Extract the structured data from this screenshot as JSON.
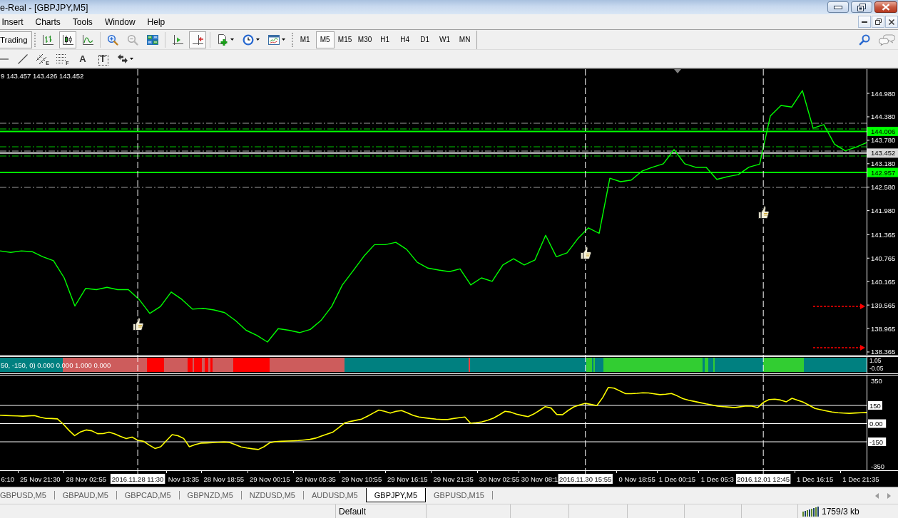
{
  "window": {
    "title": "e-Real - [GBPJPY,M5]"
  },
  "menu": [
    "Insert",
    "Charts",
    "Tools",
    "Window",
    "Help"
  ],
  "toolbar": {
    "trading": "Trading",
    "tools": [
      {
        "kind": "bars",
        "selected": false
      },
      {
        "kind": "candles",
        "selected": true
      },
      {
        "kind": "line",
        "selected": false
      },
      {
        "kind": "zoom-in",
        "selected": false
      },
      {
        "kind": "zoom-out",
        "selected": false
      },
      {
        "kind": "tile",
        "selected": false
      },
      {
        "kind": "shift",
        "selected": false
      },
      {
        "kind": "autoscroll",
        "selected": true
      },
      {
        "kind": "new-chart",
        "selected": false
      },
      {
        "kind": "periods",
        "selected": false
      },
      {
        "kind": "templates",
        "selected": false
      }
    ],
    "timeframes": [
      {
        "label": "M1",
        "selected": false
      },
      {
        "label": "M5",
        "selected": true
      },
      {
        "label": "M15",
        "selected": false
      },
      {
        "label": "M30",
        "selected": false
      },
      {
        "label": "H1",
        "selected": false
      },
      {
        "label": "H4",
        "selected": false
      },
      {
        "label": "D1",
        "selected": false
      },
      {
        "label": "W1",
        "selected": false
      },
      {
        "label": "MN",
        "selected": false
      }
    ]
  },
  "drawing_tools": [
    {
      "kind": "hline"
    },
    {
      "kind": "trendline"
    },
    {
      "kind": "channel",
      "label": "E"
    },
    {
      "kind": "fibo",
      "label": "F"
    },
    {
      "kind": "text",
      "label": "A"
    },
    {
      "kind": "label",
      "label": "T"
    },
    {
      "kind": "arrows"
    }
  ],
  "chart": {
    "ohlc": "9 143.457 143.426 143.452",
    "chart_data": {
      "type": "line",
      "ylim": [
        138.31,
        145.6
      ],
      "categories": [
        null,
        null,
        null,
        null,
        null,
        null,
        null,
        null,
        null,
        null,
        null,
        null,
        null,
        null,
        null,
        null,
        null,
        null,
        null,
        null,
        null,
        null,
        null,
        null,
        null,
        null,
        null,
        null,
        null,
        null,
        null,
        null,
        null,
        null,
        null,
        null,
        null,
        null,
        null,
        null,
        null,
        null,
        null,
        null,
        null,
        null,
        null,
        null,
        null,
        null,
        null,
        null,
        null,
        null,
        null,
        null,
        null,
        null,
        null,
        null,
        null,
        null,
        null,
        null,
        null,
        null,
        null,
        null,
        null,
        null,
        null,
        null,
        null,
        null,
        null,
        null,
        null,
        null,
        null,
        null,
        null,
        null
      ],
      "series": [
        {
          "color": "#00ff00",
          "values": [
            140.95,
            140.91,
            140.95,
            140.93,
            140.8,
            140.7,
            140.26,
            139.54,
            139.99,
            139.96,
            140.02,
            139.96,
            139.96,
            139.71,
            139.35,
            139.53,
            139.9,
            139.71,
            139.46,
            139.48,
            139.44,
            139.37,
            139.17,
            138.92,
            138.79,
            138.62,
            138.96,
            138.92,
            138.86,
            138.94,
            139.17,
            139.53,
            140.08,
            140.44,
            140.81,
            141.11,
            141.11,
            141.17,
            140.99,
            140.66,
            140.51,
            140.46,
            140.42,
            140.49,
            140.08,
            140.26,
            140.17,
            140.59,
            140.75,
            140.59,
            140.72,
            141.35,
            140.8,
            140.9,
            141.26,
            141.54,
            141.4,
            142.81,
            142.72,
            142.76,
            142.99,
            143.09,
            143.18,
            143.54,
            143.18,
            143.09,
            143.09,
            142.78,
            142.85,
            142.9,
            143.09,
            143.17,
            144.4,
            144.67,
            144.63,
            145.05,
            144.09,
            144.18,
            143.68,
            143.51,
            143.6,
            143.72
          ]
        }
      ],
      "yticks": [
        {
          "value": 144.98,
          "label": "144.980"
        },
        {
          "value": 144.38,
          "label": "144.380"
        },
        {
          "value": 143.78,
          "label": "143.780"
        },
        {
          "value": 143.18,
          "label": "143.180"
        },
        {
          "value": 142.58,
          "label": "142.580"
        },
        {
          "value": 141.98,
          "label": "141.980"
        },
        {
          "value": 141.365,
          "label": "141.365"
        },
        {
          "value": 140.765,
          "label": "140.765"
        },
        {
          "value": 140.165,
          "label": "140.165"
        },
        {
          "value": 139.565,
          "label": "139.565"
        },
        {
          "value": 138.965,
          "label": "138.965"
        },
        {
          "value": 138.365,
          "label": "138.365"
        }
      ],
      "ref_lines": [
        {
          "axis": "y",
          "value": 144.215,
          "color": "#a0a0a0"
        },
        {
          "axis": "y",
          "value": 144.069,
          "color": "#00c800"
        },
        {
          "axis": "y",
          "value": 144.006,
          "color": "#00ff00",
          "label": "144.006"
        },
        {
          "axis": "y",
          "value": 143.613,
          "color": "#00c800"
        },
        {
          "axis": "y",
          "value": 143.504,
          "color": "#a0a0a0"
        },
        {
          "axis": "y",
          "value": 143.452,
          "color": "#d8d8d8",
          "label": "143.452"
        },
        {
          "axis": "y",
          "value": 143.377,
          "color": "#00c800"
        },
        {
          "axis": "y",
          "value": 142.957,
          "color": "#00ff00",
          "label": "142.957"
        },
        {
          "axis": "y",
          "value": 142.575,
          "color": "#a0a0a0"
        }
      ]
    }
  },
  "strip": {
    "label": "50, -150, 0) 0.000 0.000 1.000 0.000",
    "axis": [
      "1.05",
      "-0.05"
    ]
  },
  "oscillator": {
    "chart_data": {
      "type": "line",
      "ylim": [
        -385,
        397
      ],
      "categories": [
        null,
        "6:10",
        null,
        null,
        null,
        null,
        null,
        "25 Nov 21:30",
        null,
        null,
        null,
        null,
        null,
        null,
        null,
        "28 Nov 02:55",
        null,
        null,
        null,
        null,
        null,
        null,
        null,
        null,
        "2016.11.28 11:30",
        null,
        null,
        null,
        null,
        null,
        null,
        null,
        "Nov 13:35",
        null,
        null,
        null,
        null,
        null,
        null,
        "28 Nov 18:55",
        null,
        null,
        null,
        null,
        null,
        null,
        null,
        "29 Nov 00:15",
        null,
        null,
        null,
        null,
        null,
        null,
        null,
        "29 Nov 05:35",
        null,
        null,
        null,
        null,
        null,
        null,
        null,
        "29 Nov 10:55",
        null,
        null,
        null,
        null,
        null,
        null,
        null,
        "29 Nov 16:15",
        null,
        null,
        null,
        null,
        null,
        null,
        null,
        "29 Nov 21:35",
        null,
        null,
        null,
        null,
        null,
        null,
        null,
        "30 Nov 02:55",
        null,
        null,
        null,
        null,
        null,
        null,
        "30 Nov 08:1",
        null,
        null,
        null,
        null,
        null,
        null,
        null,
        "2016.11.30 15:55",
        null,
        null,
        null,
        null,
        null,
        null,
        null,
        null,
        "0 Nov 18:55",
        null,
        null,
        null,
        null,
        null,
        null,
        "1 Dec 00:15",
        null,
        null,
        null,
        null,
        null,
        null,
        "1 Dec 05:3",
        null,
        null,
        null,
        null,
        null,
        null,
        null,
        "2016.12.01 12:45",
        null,
        null,
        null,
        null,
        null,
        null,
        null,
        null,
        "1 Dec 16:15",
        null,
        null,
        null,
        null,
        null,
        null,
        null,
        "1 Dec 21:35",
        null
      ],
      "series": [
        {
          "color": "#ffff00",
          "values": [
            69,
            67,
            65,
            63,
            61,
            64,
            66,
            53,
            43,
            42,
            39,
            -3,
            -55,
            -99,
            -69,
            -52,
            -59,
            -83,
            -82,
            -70,
            -86,
            -106,
            -124,
            -111,
            -138,
            -146,
            -177,
            -205,
            -191,
            -141,
            -91,
            -100,
            -123,
            -191,
            -174,
            -161,
            -159,
            -157,
            -154,
            -152,
            -155,
            -174,
            -192,
            -201,
            -208,
            -214,
            -191,
            -158,
            -148,
            -146,
            -144,
            -142,
            -140,
            -135,
            -130,
            -120,
            -103,
            -87,
            -70,
            -34,
            4,
            17,
            27,
            37,
            60,
            86,
            112,
            102,
            87,
            102,
            108,
            88,
            68,
            54,
            48,
            42,
            37,
            34,
            34,
            42,
            49,
            55,
            3,
            8,
            14,
            28,
            46,
            72,
            101,
            95,
            78,
            67,
            58,
            79,
            109,
            140,
            129,
            76,
            73,
            109,
            138,
            154,
            167,
            158,
            149,
            214,
            299,
            293,
            270,
            247,
            247,
            250,
            254,
            253,
            246,
            239,
            243,
            249,
            229,
            206,
            193,
            183,
            173,
            163,
            154,
            144,
            140,
            136,
            132,
            139,
            146,
            144,
            132,
            175,
            199,
            202,
            195,
            180,
            209,
            193,
            176,
            151,
            125,
            115,
            105,
            96,
            90,
            87,
            85,
            88,
            90,
            92
          ]
        }
      ],
      "yticks": [
        {
          "value": 350,
          "label": "350"
        },
        {
          "value": -350,
          "label": "-350"
        }
      ],
      "ref_lines": [
        {
          "axis": "y",
          "value": 150,
          "label": "150"
        },
        {
          "axis": "y",
          "value": 0,
          "label": "0.00"
        },
        {
          "axis": "y",
          "value": -150,
          "label": "-150"
        }
      ]
    }
  },
  "tabs": [
    {
      "label": "GBPUSD,M5",
      "selected": false
    },
    {
      "label": "GBPAUD,M5",
      "selected": false
    },
    {
      "label": "GBPCAD,M5",
      "selected": false
    },
    {
      "label": "GBPNZD,M5",
      "selected": false
    },
    {
      "label": "NZDUSD,M5",
      "selected": false
    },
    {
      "label": "AUDUSD,M5",
      "selected": false
    },
    {
      "label": "GBPJPY,M5",
      "selected": true
    },
    {
      "label": "GBPUSD,M15",
      "selected": false
    }
  ],
  "status_bar": {
    "profile": "Default",
    "traffic": "1759/3 kb"
  }
}
